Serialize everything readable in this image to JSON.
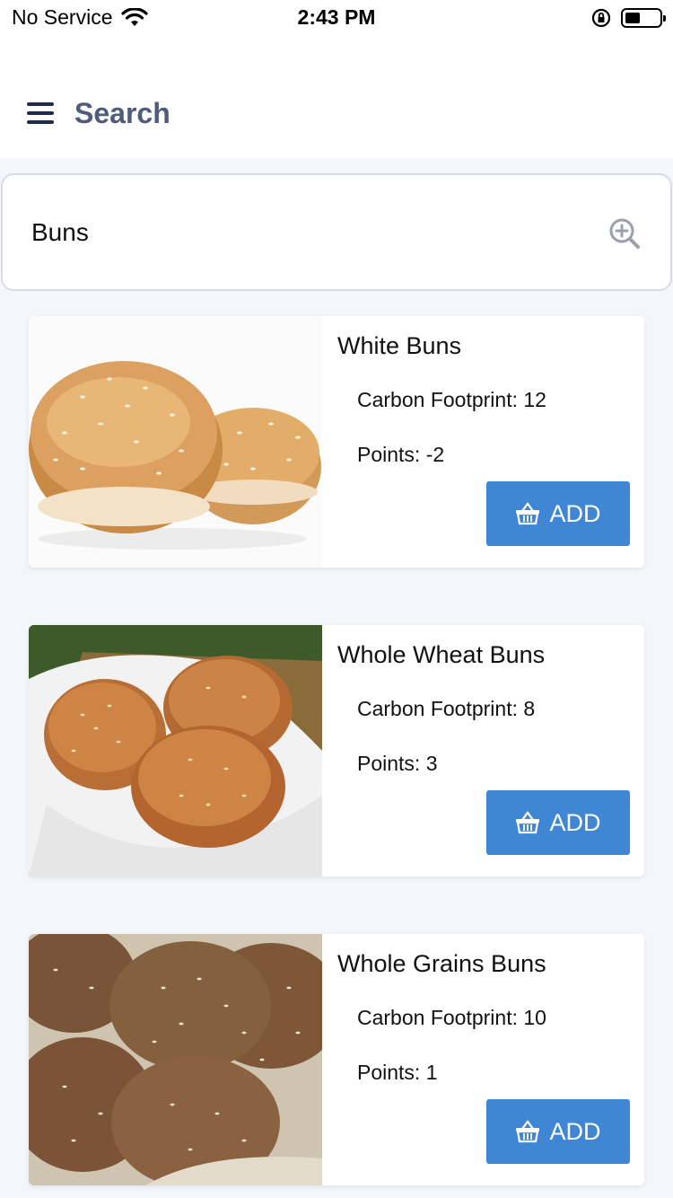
{
  "status_bar": {
    "carrier": "No Service",
    "time": "2:43 PM",
    "icons": [
      "wifi-icon",
      "orientation-lock-icon",
      "battery-icon"
    ]
  },
  "header": {
    "menu_icon": "hamburger-menu-icon",
    "title": "Search"
  },
  "search": {
    "value": "Buns",
    "icon": "zoom-in-icon"
  },
  "colors": {
    "accent": "#3f86d4",
    "header_title": "#4e5b7c",
    "menu_icon": "#1d2c4c",
    "background": "#f4f6fb"
  },
  "products": [
    {
      "name": "White Buns",
      "carbon": "Carbon Footprint: 12",
      "points": "Points: -2",
      "add_label": "ADD",
      "add_icon": "basket-icon"
    },
    {
      "name": "Whole Wheat Buns",
      "carbon": "Carbon Footprint: 8",
      "points": "Points: 3",
      "add_label": "ADD",
      "add_icon": "basket-icon"
    },
    {
      "name": "Whole Grains Buns",
      "carbon": "Carbon Footprint: 10",
      "points": "Points: 1",
      "add_label": "ADD",
      "add_icon": "basket-icon"
    }
  ]
}
